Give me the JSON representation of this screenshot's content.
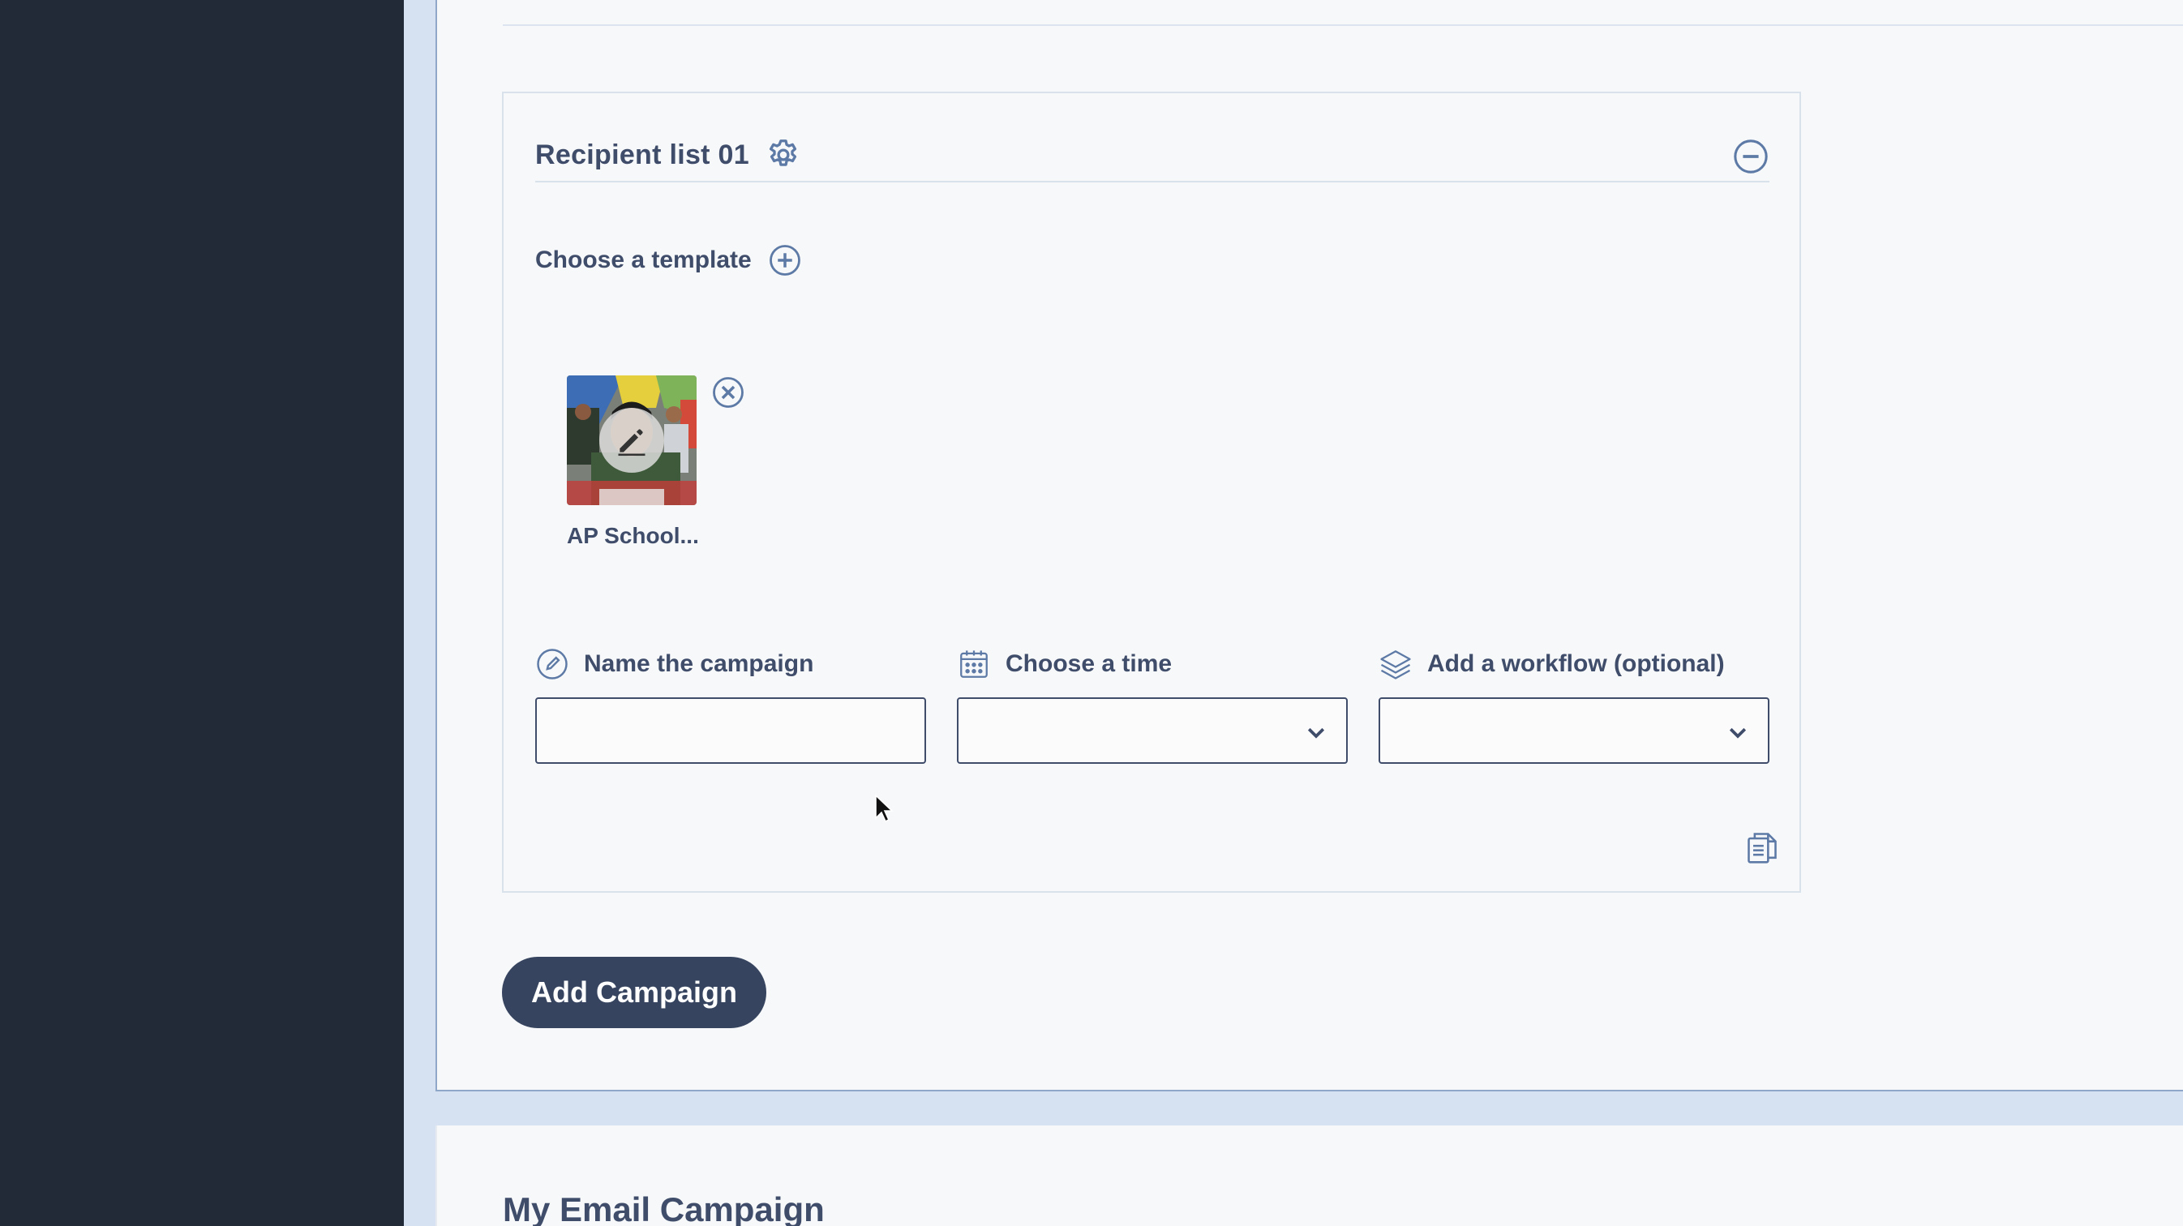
{
  "recipient_list": {
    "title": "Recipient list 01"
  },
  "template": {
    "choose_label": "Choose a template",
    "selected_name": "AP School..."
  },
  "fields": {
    "name_label": "Name the campaign",
    "name_value": "",
    "time_label": "Choose a time",
    "time_value": "",
    "workflow_label": "Add a workflow (optional)",
    "workflow_value": ""
  },
  "actions": {
    "add_campaign_label": "Add Campaign"
  },
  "section": {
    "title": "My Email Campaign"
  },
  "colors": {
    "sidebar": "#222a38",
    "primary_button": "#36445f",
    "text": "#3f4d6b"
  },
  "icons": [
    "gear-icon",
    "minus-circle-icon",
    "plus-circle-icon",
    "remove-circle-icon",
    "pencil-icon",
    "calendar-icon",
    "layers-icon",
    "chevron-down-icon",
    "copy-icon"
  ]
}
